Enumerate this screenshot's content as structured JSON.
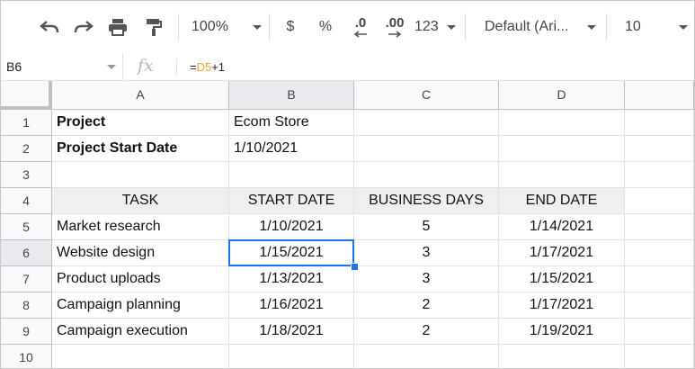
{
  "toolbar": {
    "zoom": "100%",
    "currency": "$",
    "percent": "%",
    "dec_decrease": ".0",
    "dec_increase": ".00",
    "more_formats": "123",
    "font": "Default (Ari...",
    "font_size": "10"
  },
  "formula_bar": {
    "cell_ref": "B6",
    "fx_label": "fx",
    "formula_prefix": "=",
    "formula_ref": "D5",
    "formula_suffix": "+1"
  },
  "columns": [
    "A",
    "B",
    "C",
    "D"
  ],
  "rows": [
    "1",
    "2",
    "3",
    "4",
    "5",
    "6",
    "7",
    "8",
    "9",
    "10"
  ],
  "cells": {
    "A1": "Project",
    "B1": "Ecom Store",
    "A2": "Project Start Date",
    "B2": "1/10/2021",
    "A4": "TASK",
    "B4": "START DATE",
    "C4": "BUSINESS DAYS",
    "D4": "END DATE",
    "A5": "Market research",
    "B5": "1/10/2021",
    "C5": "5",
    "D5": "1/14/2021",
    "A6": "Website design",
    "B6": "1/15/2021",
    "C6": "3",
    "D6": "1/17/2021",
    "A7": "Product uploads",
    "B7": "1/13/2021",
    "C7": "3",
    "D7": "1/15/2021",
    "A8": "Campaign planning",
    "B8": "1/16/2021",
    "C8": "2",
    "D8": "1/17/2021",
    "A9": "Campaign execution",
    "B9": "1/18/2021",
    "C9": "2",
    "D9": "1/19/2021"
  },
  "colors": {
    "accent": "#1a73e8",
    "header_fill": "#efefef",
    "formula_ref": "#e8a33b"
  },
  "selected_cell": "B6"
}
